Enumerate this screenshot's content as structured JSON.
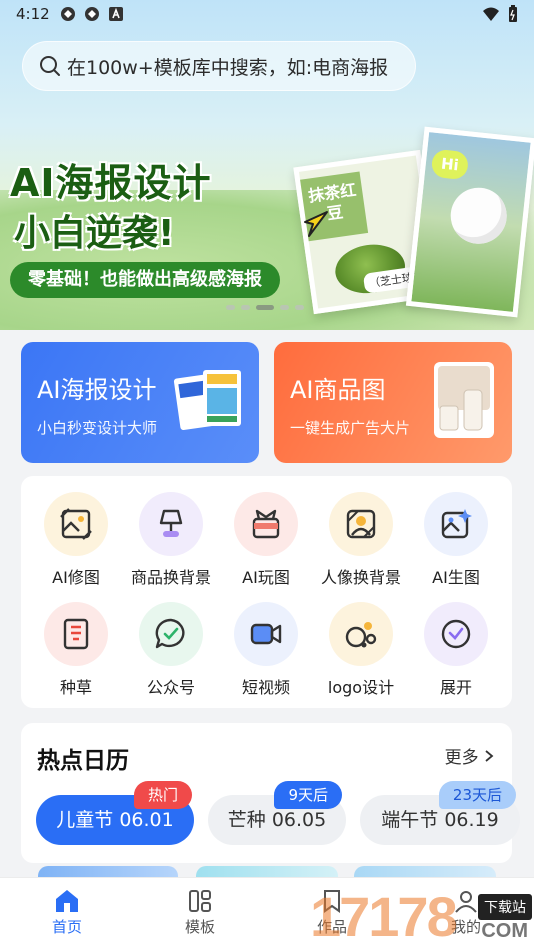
{
  "status": {
    "time": "4:12"
  },
  "search": {
    "placeholder": "在100w+模板库中搜索，如:电商海报"
  },
  "banner": {
    "title": "AI海报设计",
    "subtitle": "小白逆袭!",
    "pill": "零基础！也能做出高级感海报",
    "poster1_band": "抹茶红豆",
    "poster1_tag": "（芝士球）",
    "poster2_hi": "Hi",
    "active_slide": 3,
    "slide_count": 5
  },
  "cards": [
    {
      "title": "AI海报设计",
      "sub": "小白秒变设计大师"
    },
    {
      "title": "AI商品图",
      "sub": "一键生成广告大片"
    }
  ],
  "tools": [
    {
      "label": "AI修图",
      "icon": "photo-edit-icon",
      "color": "#fdf3dd"
    },
    {
      "label": "商品换背景",
      "icon": "lamp-icon",
      "color": "#f1ecfc"
    },
    {
      "label": "AI玩图",
      "icon": "gift-box-icon",
      "color": "#fde9e7"
    },
    {
      "label": "人像换背景",
      "icon": "portrait-icon",
      "color": "#fdf3dd"
    },
    {
      "label": "AI生图",
      "icon": "image-sparkle-icon",
      "color": "#ecf1fd"
    },
    {
      "label": "种草",
      "icon": "red-book-icon",
      "color": "#fde9e7"
    },
    {
      "label": "公众号",
      "icon": "chat-bubble-icon",
      "color": "#e8f7ee"
    },
    {
      "label": "短视频",
      "icon": "video-camera-icon",
      "color": "#ecf1fd"
    },
    {
      "label": "logo设计",
      "icon": "shapes-icon",
      "color": "#fdf3dd"
    },
    {
      "label": "展开",
      "icon": "expand-check-icon",
      "color": "#f1ecfc"
    }
  ],
  "hot": {
    "title": "热点日历",
    "more": "更多",
    "chips": [
      {
        "label": "儿童节 06.01",
        "badge": "热门"
      },
      {
        "label": "芒种 06.05",
        "badge": "9天后"
      },
      {
        "label": "端午节 06.19",
        "badge": "23天后"
      }
    ]
  },
  "nav": [
    {
      "label": "首页",
      "icon": "home-icon"
    },
    {
      "label": "模板",
      "icon": "template-icon"
    },
    {
      "label": "作品",
      "icon": "works-icon"
    },
    {
      "label": "我的",
      "icon": "profile-icon"
    }
  ],
  "watermark": {
    "number": "17178",
    "text": "下载站",
    "suffix": "COM"
  },
  "colors": {
    "primary": "#2a6ef5",
    "orange": "#ff6c3d",
    "green": "#1b5e13",
    "hot_badge": "#f04a4a"
  }
}
